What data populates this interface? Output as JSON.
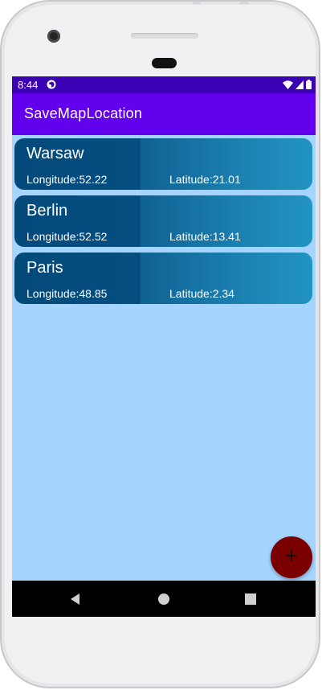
{
  "status_bar": {
    "time": "8:44"
  },
  "app_bar": {
    "title": "SaveMapLocation"
  },
  "locations": [
    {
      "name": "Warsaw",
      "longitude": "Longitude:52.22",
      "latitude": "Latitude:21.01"
    },
    {
      "name": "Berlin",
      "longitude": "Longitude:52.52",
      "latitude": "Latitude:13.41"
    },
    {
      "name": "Paris",
      "longitude": "Longitude:48.85",
      "latitude": "Latitude:2.34"
    }
  ],
  "fab": {
    "label": "+",
    "color": "#7a0000"
  },
  "colors": {
    "status_bar": "#3a00b4",
    "app_bar": "#6200ee",
    "background": "#a5d5ff",
    "card_start": "#034a7b",
    "card_end": "#2294c2"
  },
  "icons": {
    "status": [
      "app-notification-icon",
      "wifi-icon",
      "signal-icon",
      "battery-icon"
    ],
    "nav": [
      "back-icon",
      "home-icon",
      "recents-icon"
    ]
  }
}
